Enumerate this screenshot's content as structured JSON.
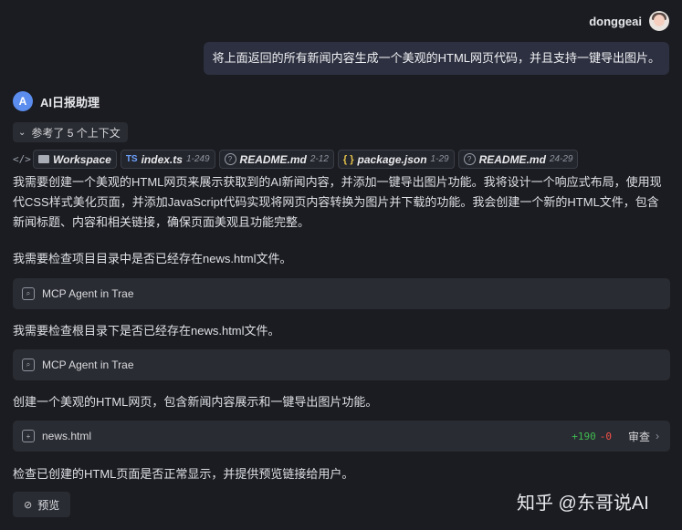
{
  "user": {
    "name": "donggeai",
    "message": "将上面返回的所有新闻内容生成一个美观的HTML网页代码，并且支持一键导出图片。"
  },
  "assistant": {
    "avatar_letter": "A",
    "name": "AI日报助理",
    "context_label": "参考了 5 个上下文",
    "refs": [
      {
        "icon": "folder-icon",
        "name": "Workspace",
        "range": ""
      },
      {
        "icon": "ts-icon",
        "icon_text": "TS",
        "name": "index.ts",
        "range": "1-249"
      },
      {
        "icon": "help-circle-icon",
        "name": "README.md",
        "range": "2-12"
      },
      {
        "icon": "braces-icon",
        "icon_text": "{ }",
        "name": "package.json",
        "range": "1-29"
      },
      {
        "icon": "help-circle-icon",
        "name": "README.md",
        "range": "24-29"
      }
    ],
    "para1": "我需要创建一个美观的HTML网页来展示获取到的AI新闻内容，并添加一键导出图片功能。我将设计一个响应式布局，使用现代CSS样式美化页面，并添加JavaScript代码实现将网页内容转换为图片并下载的功能。我会创建一个新的HTML文件，包含新闻标题、内容和相关链接，确保页面美观且功能完整。",
    "para2": "我需要检查项目目录中是否已经存在news.html文件。",
    "tool1": "MCP Agent in Trae",
    "para3": "我需要检查根目录下是否已经存在news.html文件。",
    "tool2": "MCP Agent in Trae",
    "para4": "创建一个美观的HTML网页，包含新闻内容展示和一键导出图片功能。",
    "file": {
      "name": "news.html",
      "added": "+190",
      "removed": "-0",
      "review_label": "审查"
    },
    "para5": "检查已创建的HTML页面是否正常显示，并提供预览链接给用户。",
    "preview_label": "预览"
  },
  "watermark": "知乎 @东哥说AI"
}
